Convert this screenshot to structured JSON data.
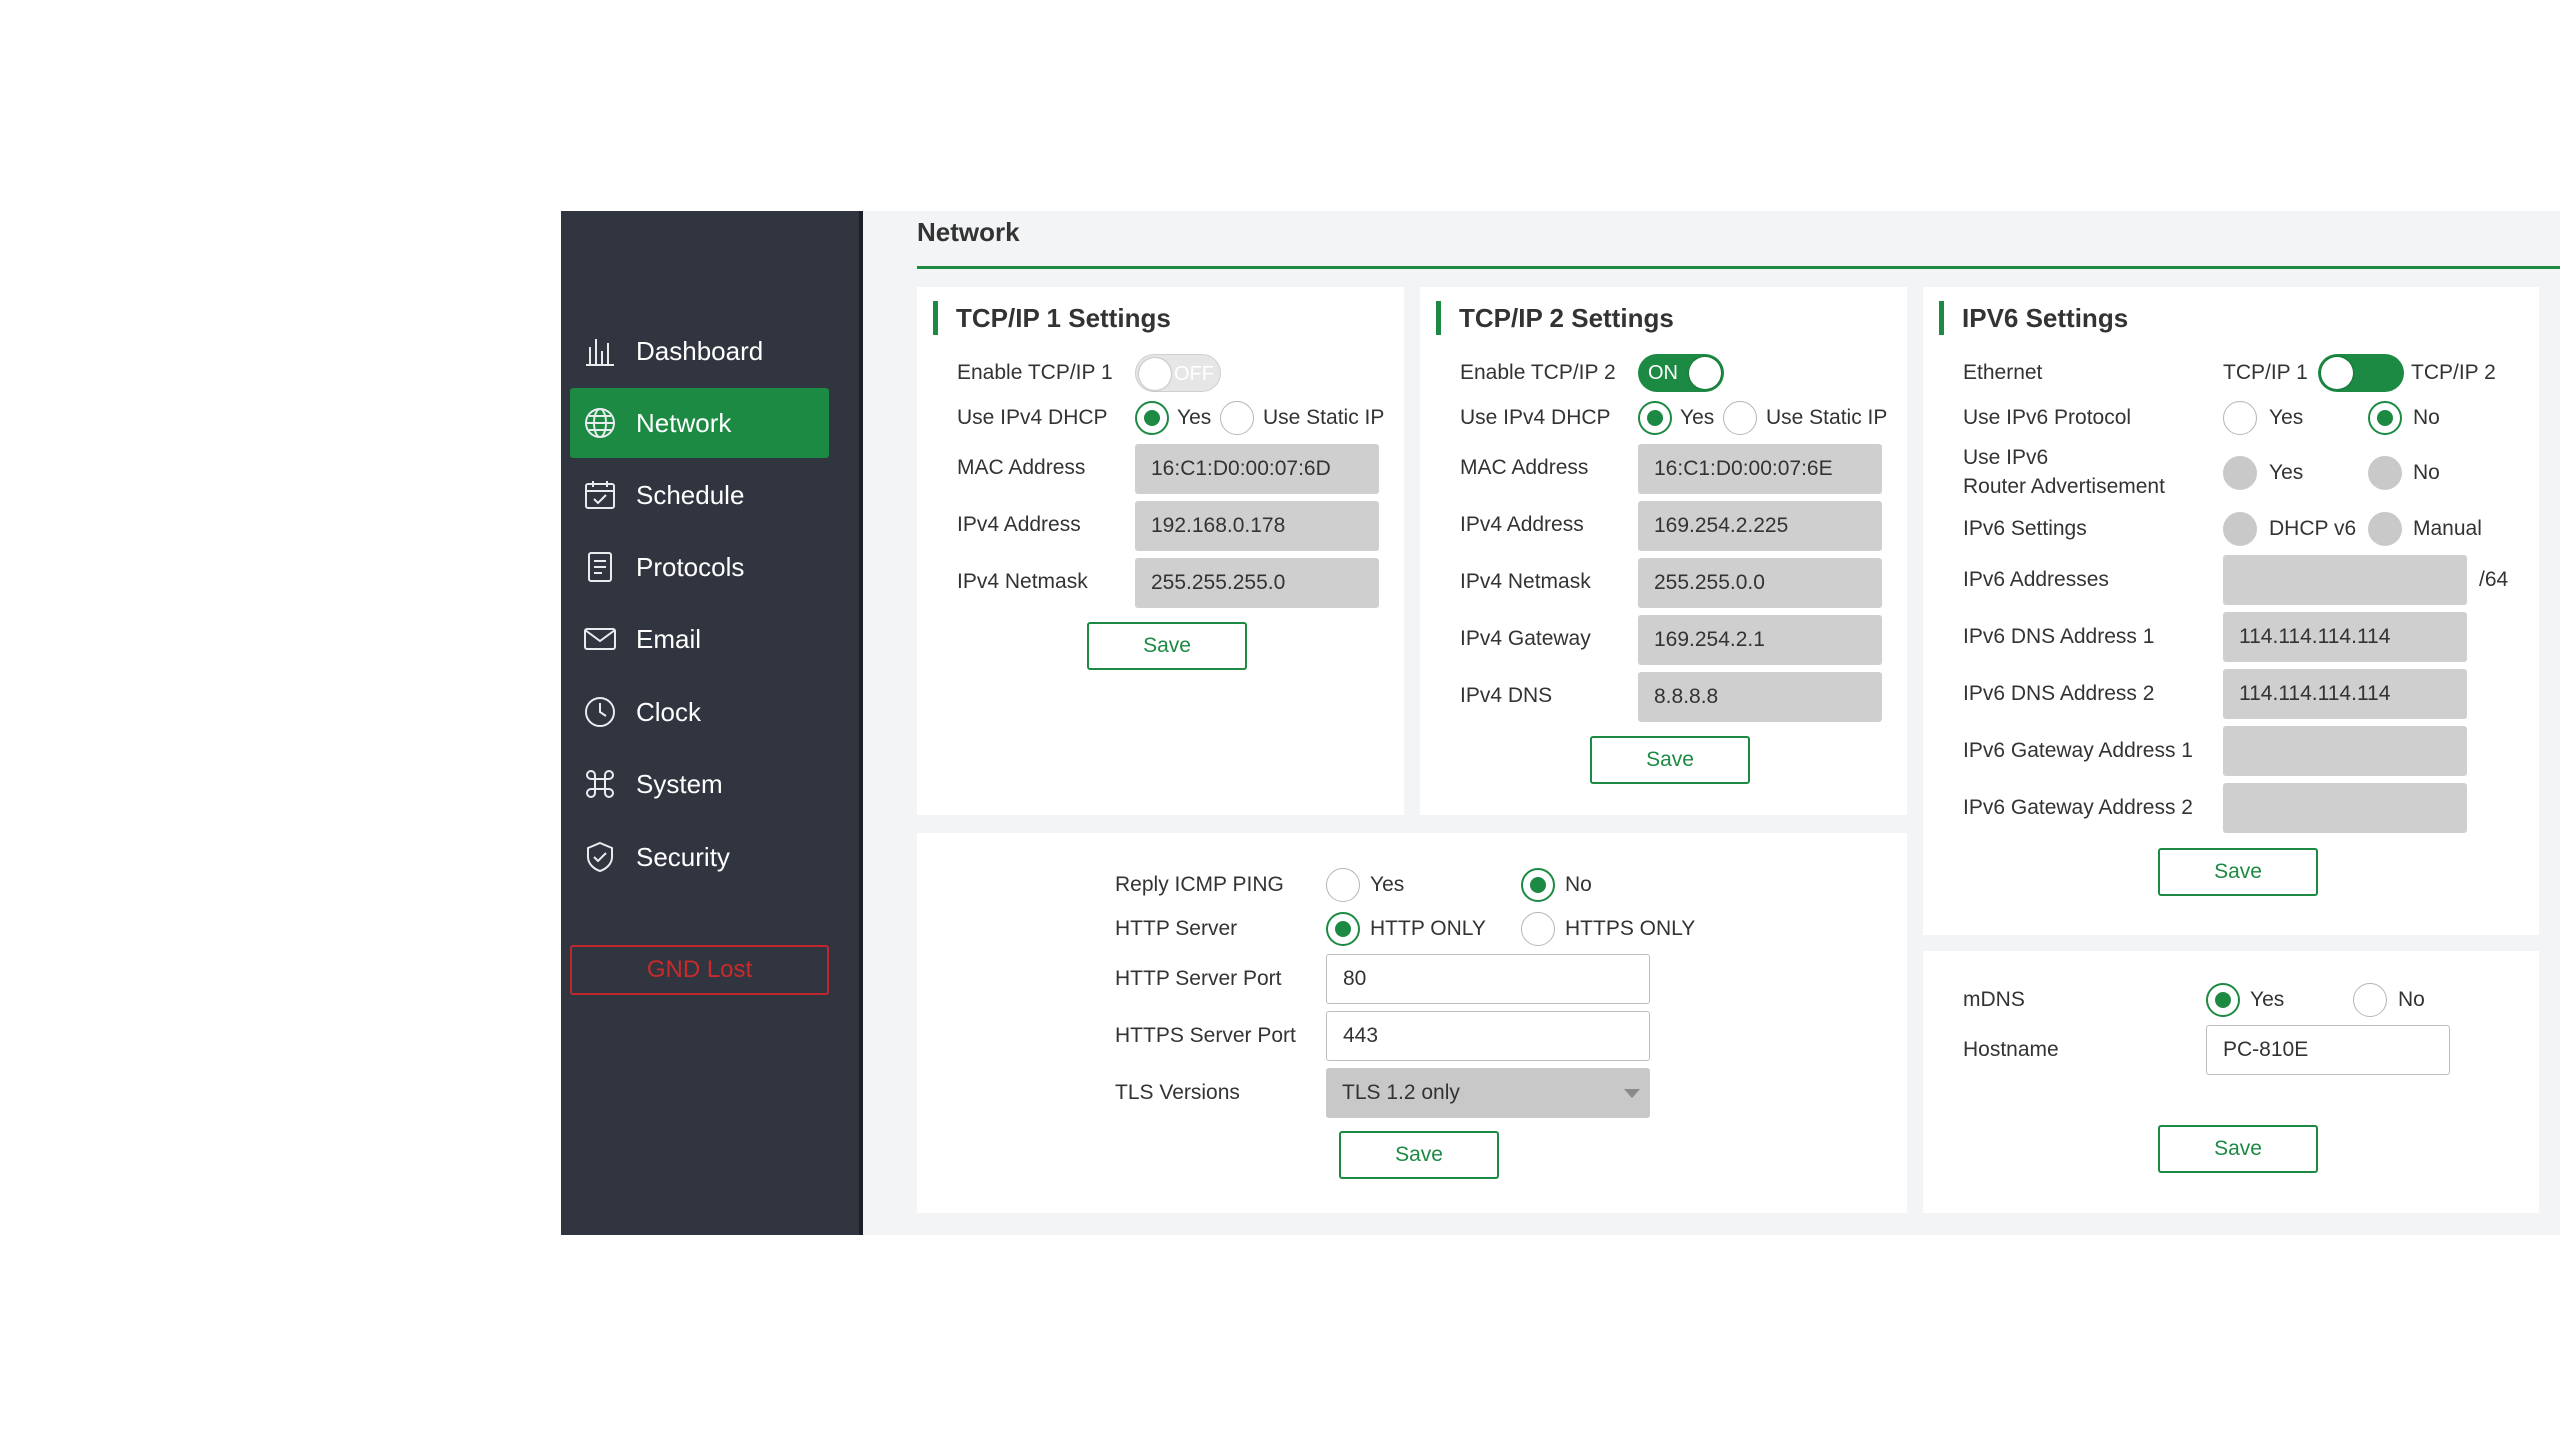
{
  "sidebar": {
    "items": [
      {
        "label": "Dashboard",
        "icon": "bar-chart-icon"
      },
      {
        "label": "Network",
        "icon": "globe-icon",
        "active": true
      },
      {
        "label": "Schedule",
        "icon": "calendar-icon"
      },
      {
        "label": "Protocols",
        "icon": "document-icon"
      },
      {
        "label": "Email",
        "icon": "envelope-icon"
      },
      {
        "label": "Clock",
        "icon": "clock-icon"
      },
      {
        "label": "System",
        "icon": "command-icon"
      },
      {
        "label": "Security",
        "icon": "shield-icon"
      }
    ],
    "status": "GND Lost"
  },
  "page": {
    "title": "Network"
  },
  "tcpip1": {
    "title": "TCP/IP 1 Settings",
    "enable_label": "Enable TCP/IP 1",
    "enable_state": "OFF",
    "dhcp_label": "Use IPv4 DHCP",
    "dhcp_yes": "Yes",
    "dhcp_static": "Use Static IP",
    "mac_label": "MAC Address",
    "mac": "16:C1:D0:00:07:6D",
    "ipv4_label": "IPv4 Address",
    "ipv4": "192.168.0.178",
    "netmask_label": "IPv4 Netmask",
    "netmask": "255.255.255.0",
    "save": "Save"
  },
  "tcpip2": {
    "title": "TCP/IP 2 Settings",
    "enable_label": "Enable TCP/IP 2",
    "enable_state": "ON",
    "dhcp_label": "Use IPv4 DHCP",
    "dhcp_yes": "Yes",
    "dhcp_static": "Use Static IP",
    "mac_label": "MAC Address",
    "mac": "16:C1:D0:00:07:6E",
    "ipv4_label": "IPv4 Address",
    "ipv4": "169.254.2.225",
    "netmask_label": "IPv4 Netmask",
    "netmask": "255.255.0.0",
    "gateway_label": "IPv4 Gateway",
    "gateway": "169.254.2.1",
    "dns_label": "IPv4 DNS",
    "dns": "8.8.8.8",
    "save": "Save"
  },
  "ipv6": {
    "title": "IPV6 Settings",
    "ethernet_label": "Ethernet",
    "ethernet_left": "TCP/IP 1",
    "ethernet_right": "TCP/IP 2",
    "protocol_label": "Use IPv6 Protocol",
    "protocol_yes": "Yes",
    "protocol_no": "No",
    "ra_label_1": "Use IPv6",
    "ra_label_2": "Router Advertisement",
    "ra_yes": "Yes",
    "ra_no": "No",
    "settings_label": "IPv6 Settings",
    "settings_dhcp": "DHCP v6",
    "settings_manual": "Manual",
    "addresses_label": "IPv6 Addresses",
    "addresses": "",
    "prefix": "/64",
    "dns1_label": "IPv6 DNS Address 1",
    "dns1": "114.114.114.114",
    "dns2_label": "IPv6 DNS Address 2",
    "dns2": "114.114.114.114",
    "gw1_label": "IPv6 Gateway Address 1",
    "gw1": "",
    "gw2_label": "IPv6 Gateway Address 2",
    "gw2": "",
    "save": "Save"
  },
  "server": {
    "icmp_label": "Reply ICMP PING",
    "icmp_yes": "Yes",
    "icmp_no": "No",
    "http_label": "HTTP Server",
    "http_only": "HTTP ONLY",
    "https_only": "HTTPS ONLY",
    "http_port_label": "HTTP Server Port",
    "http_port": "80",
    "https_port_label": "HTTPS Server Port",
    "https_port": "443",
    "tls_label": "TLS Versions",
    "tls": "TLS 1.2 only",
    "save": "Save"
  },
  "mdns": {
    "label": "mDNS",
    "yes": "Yes",
    "no": "No",
    "hostname_label": "Hostname",
    "hostname": "PC-810E",
    "save": "Save"
  },
  "colors": {
    "accent": "#1c8a43",
    "sidebar": "#30353f",
    "error": "#c92a2a",
    "readonly_field": "#cfcfcf"
  }
}
